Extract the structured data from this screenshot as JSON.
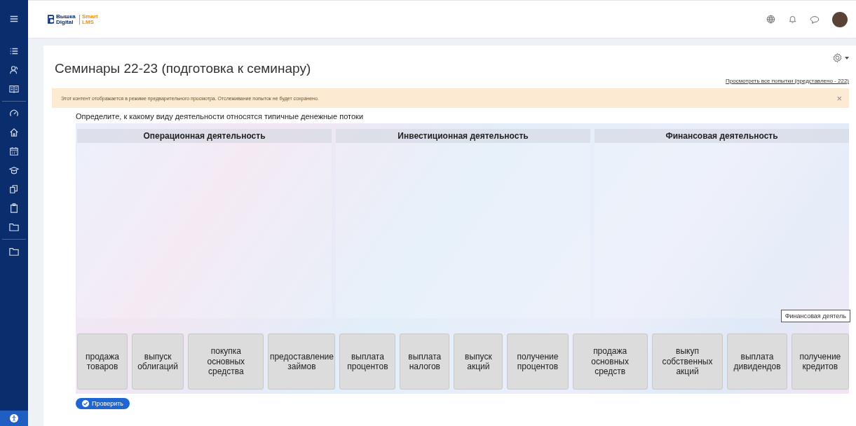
{
  "logo": {
    "primary": "Вышка Digital",
    "secondary": "Smart LMS"
  },
  "page": {
    "title": "Семинары 22-23 (подготовка к семинару)",
    "attempts_link": "Просмотреть все попытки (представлено - 222)"
  },
  "alert": {
    "text": "Этот контент отображается в режиме предварительного просмотра. Отслеживание попыток не будет сохранено.",
    "close": "×"
  },
  "question": "Определите, к какому виду деятельности относятся типичные денежные потоки",
  "columns": [
    "Операционная деятельность",
    "Инвестиционная деятельность",
    "Финансовая деятельность"
  ],
  "tiles": [
    {
      "label": "продажа товаров"
    },
    {
      "label": "выпуск облигаций"
    },
    {
      "label": "покупка основных средства"
    },
    {
      "label": "предоставление займов"
    },
    {
      "label": "выплата процентов"
    },
    {
      "label": "выплата налогов"
    },
    {
      "label": "выпуск акций"
    },
    {
      "label": "получение процентов"
    },
    {
      "label": "продажа основных средств"
    },
    {
      "label": "выкуп собственных акций"
    },
    {
      "label": "выплата дивидендов"
    },
    {
      "label": "получение кредитов"
    }
  ],
  "tooltip": "Финансовая деятель",
  "check_button": "Проверить"
}
